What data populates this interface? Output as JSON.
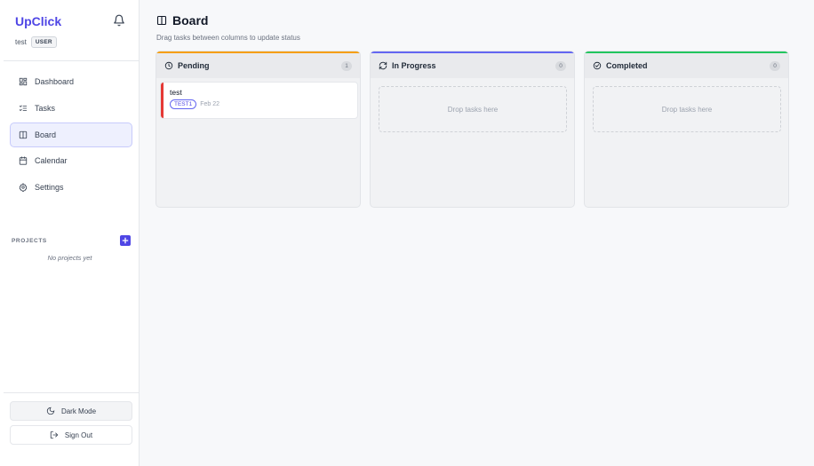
{
  "app": {
    "name": "UpClick"
  },
  "user": {
    "name": "test",
    "role": "USER"
  },
  "nav": {
    "items": [
      {
        "label": "Dashboard",
        "icon": "dashboard-icon"
      },
      {
        "label": "Tasks",
        "icon": "tasks-icon"
      },
      {
        "label": "Board",
        "icon": "board-icon",
        "active": true
      },
      {
        "label": "Calendar",
        "icon": "calendar-icon"
      },
      {
        "label": "Settings",
        "icon": "settings-icon"
      }
    ]
  },
  "projects": {
    "label": "PROJECTS",
    "empty_text": "No projects yet"
  },
  "footer": {
    "dark_mode_label": "Dark Mode",
    "sign_out_label": "Sign Out"
  },
  "page": {
    "title": "Board",
    "subtitle": "Drag tasks between columns to update status"
  },
  "columns": [
    {
      "title": "Pending",
      "count": "1",
      "accent": "#f59e0b",
      "tasks": [
        {
          "title": "test",
          "tag": "TEST1",
          "date": "Feb 22",
          "priority_color": "#e53935"
        }
      ]
    },
    {
      "title": "In Progress",
      "count": "0",
      "accent": "#6366f1",
      "drop_text": "Drop tasks here"
    },
    {
      "title": "Completed",
      "count": "0",
      "accent": "#22c55e",
      "drop_text": "Drop tasks here"
    }
  ],
  "colors": {
    "brand": "#4f46e5"
  }
}
